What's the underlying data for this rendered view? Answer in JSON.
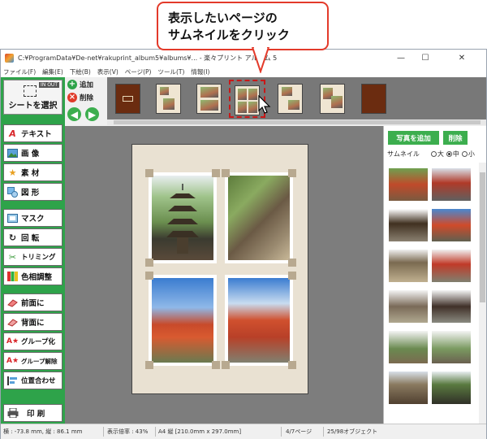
{
  "callout": {
    "line1": "表示したいページの",
    "line2": "サムネイルをクリック"
  },
  "window": {
    "title": "C:¥ProgramData¥De-net¥rakuprint_album5¥albums¥... - 楽々プリント アルバム 5",
    "minimize": "—",
    "maximize": "☐",
    "close": "✕"
  },
  "menu": [
    "ファイル(F)",
    "編集(E)",
    "下絵(B)",
    "表示(V)",
    "ページ(P)",
    "ツール(T)",
    "情報(I)"
  ],
  "tools": {
    "sheet_select": "シートを選択",
    "in_out": "IN OUT",
    "text": "テキスト",
    "image": "画 像",
    "material": "素 材",
    "shape": "図 形",
    "mask": "マスク",
    "rotate": "回 転",
    "trim": "トリミング",
    "color_adjust": "色相調整",
    "front": "前面に",
    "back": "背面に",
    "group": "グループ化",
    "ungroup": "グループ解除",
    "align": "位置合わせ",
    "print": "印 刷"
  },
  "strip_controls": {
    "add": "追加",
    "delete": "削除",
    "add_symbol": "+",
    "delete_symbol": "×",
    "prev": "◀",
    "next": "▶"
  },
  "right_panel": {
    "add_photo": "写真を追加",
    "delete": "削除",
    "thumbnail_label": "サムネイル",
    "size_large": "大",
    "size_medium": "中",
    "size_small": "小",
    "selected_size": "中"
  },
  "status": {
    "coords": "横 : -73.8 mm, 縦 : 86.1 mm",
    "zoom": "表示倍率 : 43%",
    "paper": "A4 縦 [210.0mm x 297.0mm]",
    "page": "4/7ページ",
    "objects": "25/98オブジェクト"
  },
  "colors": {
    "accent_green": "#2ea34a",
    "callout_red": "#e33a2a",
    "selection_red": "#c81818",
    "page_bg": "#e9e1d2"
  }
}
